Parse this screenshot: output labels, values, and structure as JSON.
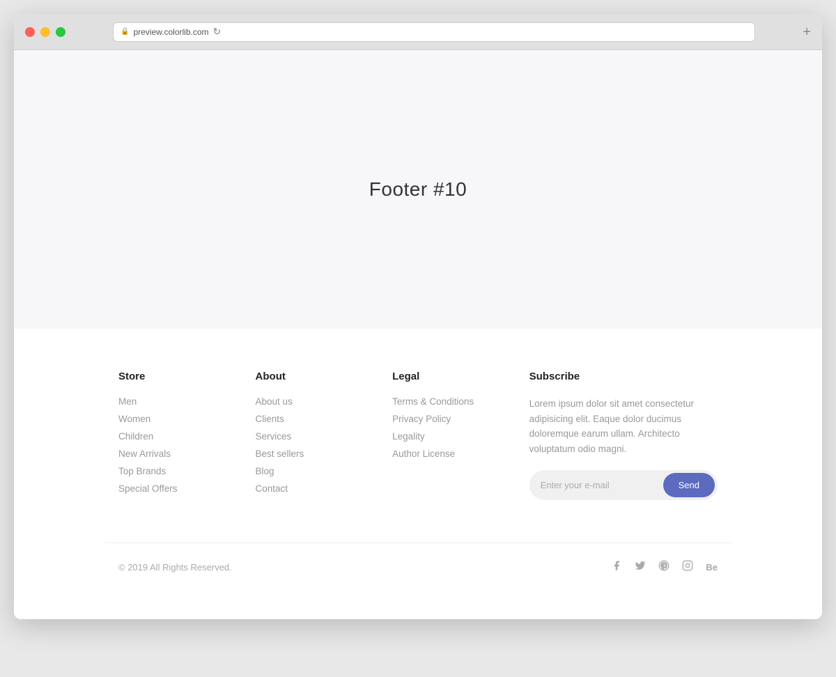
{
  "browser": {
    "url": "preview.colorlib.com",
    "newtab_symbol": "+"
  },
  "page": {
    "title": "Footer #10"
  },
  "footer": {
    "store": {
      "heading": "Store",
      "links": [
        "Men",
        "Women",
        "Children",
        "New Arrivals",
        "Top Brands",
        "Special Offers"
      ]
    },
    "about": {
      "heading": "About",
      "links": [
        "About us",
        "Clients",
        "Services",
        "Best sellers",
        "Blog",
        "Contact"
      ]
    },
    "legal": {
      "heading": "Legal",
      "links": [
        "Terms & Conditions",
        "Privacy Policy",
        "Legality",
        "Author License"
      ]
    },
    "subscribe": {
      "heading": "Subscribe",
      "description": "Lorem ipsum dolor sit amet consectetur adipisicing elit. Eaque dolor ducimus doloremque earum ullam. Architecto voluptatum odio magni.",
      "input_placeholder": "Enter your e-mail",
      "button_label": "Send"
    },
    "bottom": {
      "copyright": "© 2019 All Rights Reserved.",
      "social": [
        "f",
        "t",
        "p",
        "in",
        "Be"
      ]
    }
  }
}
